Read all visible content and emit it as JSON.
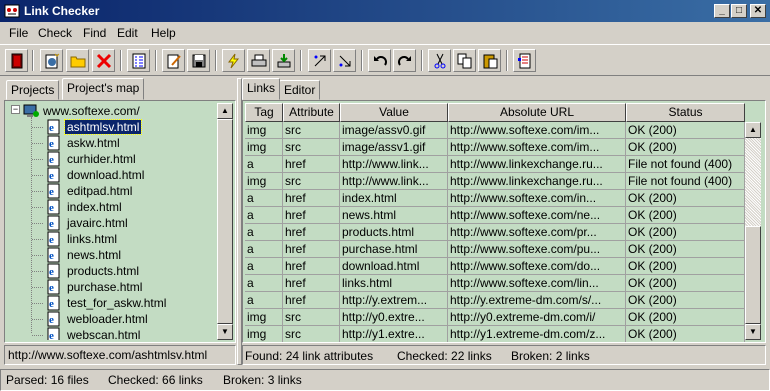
{
  "window": {
    "title": "Link Checker",
    "minimize": "_",
    "maximize": "□",
    "close": "✕"
  },
  "menu": [
    "File",
    "Check",
    "Find",
    "Edit",
    "Help"
  ],
  "toolbar": {
    "buttons": [
      "exit-icon",
      "new-project-icon",
      "open-folder-icon",
      "delete-icon",
      "properties-list-icon",
      "edit-icon",
      "save-icon",
      "check-links-icon",
      "print-icon",
      "export-icon",
      "move-up-icon",
      "move-down-icon",
      "undo-icon",
      "redo-icon",
      "cut-icon",
      "copy-icon",
      "paste-icon",
      "report-icon"
    ]
  },
  "left": {
    "tabs": [
      "Projects",
      "Project's map"
    ],
    "active_tab": "Project's map",
    "tree": {
      "root": "www.softexe.com/",
      "items": [
        "ashtmlsv.html",
        "askw.html",
        "curhider.html",
        "download.html",
        "editpad.html",
        "index.html",
        "javairc.html",
        "links.html",
        "news.html",
        "products.html",
        "purchase.html",
        "test_for_askw.html",
        "webloader.html",
        "webscan.html"
      ],
      "selected": "ashtmlsv.html"
    },
    "path": "http://www.softexe.com/ashtmlsv.html"
  },
  "right": {
    "tabs": [
      "Links",
      "Editor"
    ],
    "active_tab": "Links",
    "columns": [
      "Tag",
      "Attribute",
      "Value",
      "Absolute URL",
      "Status"
    ],
    "rows": [
      [
        "img",
        "src",
        "image/assv0.gif",
        "http://www.softexe.com/im...",
        "OK (200)"
      ],
      [
        "img",
        "src",
        "image/assv1.gif",
        "http://www.softexe.com/im...",
        "OK (200)"
      ],
      [
        "a",
        "href",
        "http://www.link...",
        "http://www.linkexchange.ru...",
        "File not found (400)"
      ],
      [
        "img",
        "src",
        "http://www.link...",
        "http://www.linkexchange.ru...",
        "File not found (400)"
      ],
      [
        "a",
        "href",
        "index.html",
        "http://www.softexe.com/in...",
        "OK (200)"
      ],
      [
        "a",
        "href",
        "news.html",
        "http://www.softexe.com/ne...",
        "OK (200)"
      ],
      [
        "a",
        "href",
        "products.html",
        "http://www.softexe.com/pr...",
        "OK (200)"
      ],
      [
        "a",
        "href",
        "purchase.html",
        "http://www.softexe.com/pu...",
        "OK (200)"
      ],
      [
        "a",
        "href",
        "download.html",
        "http://www.softexe.com/do...",
        "OK (200)"
      ],
      [
        "a",
        "href",
        "links.html",
        "http://www.softexe.com/lin...",
        "OK (200)"
      ],
      [
        "a",
        "href",
        "http://y.extrem...",
        "http://y.extreme-dm.com/s/...",
        "OK (200)"
      ],
      [
        "img",
        "src",
        "http://y0.extre...",
        "http://y0.extreme-dm.com/i/",
        "OK (200)"
      ],
      [
        "img",
        "src",
        "http://y1.extre...",
        "http://y1.extreme-dm.com/z...",
        "OK (200)"
      ]
    ],
    "status": {
      "found": "Found: 24 link attributes",
      "checked": "Checked: 22 links",
      "broken": "Broken: 2 links"
    }
  },
  "statusbar": {
    "parsed": "Parsed: 16 files",
    "checked": "Checked: 66 links",
    "broken": "Broken: 3 links"
  },
  "colors": {
    "title_bar": "#0a246a",
    "panel_background": "#c3dcc3",
    "selection": "#0a246a",
    "face": "#d4d0c8"
  }
}
